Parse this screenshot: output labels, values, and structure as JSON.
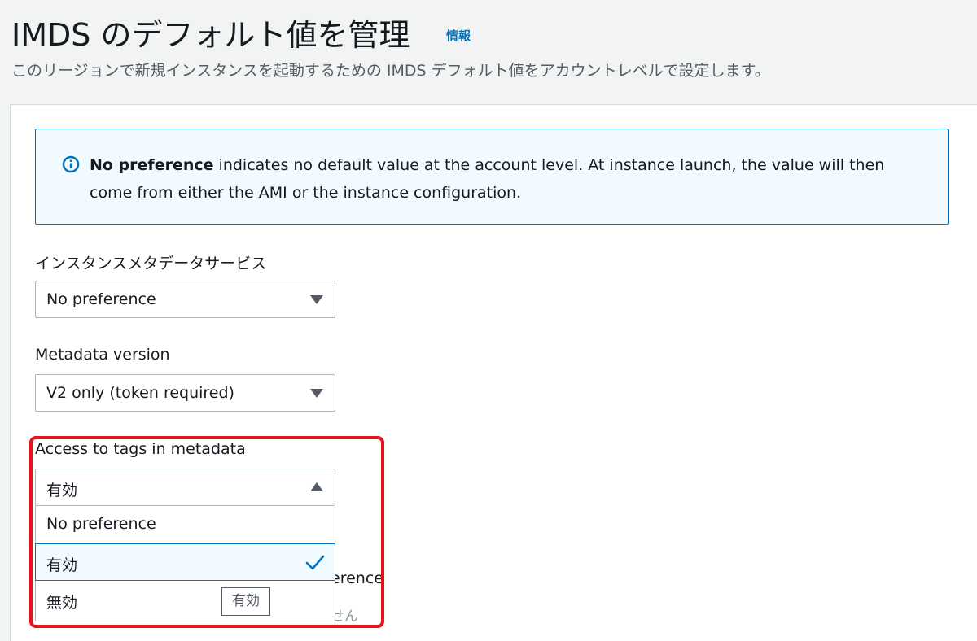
{
  "header": {
    "title": "IMDS のデフォルト値を管理",
    "info_link": "情報",
    "subtitle": "このリージョンで新規インスタンスを起動するための IMDS デフォルト値をアカウントレベルで設定します。"
  },
  "alert": {
    "icon": "info-icon",
    "bold_text": "No preference",
    "text": " indicates no default value at the account level. At instance launch, the value will then come from either the AMI or the instance configuration."
  },
  "fields": {
    "metadata_service": {
      "label": "インスタンスメタデータサービス",
      "value": "No preference"
    },
    "metadata_version": {
      "label": "Metadata version",
      "value": "V2 only (token required)"
    },
    "tags_access": {
      "label": "Access to tags in metadata",
      "value": "有効",
      "options": [
        "No preference",
        "有効",
        "無効"
      ],
      "selected_index": 1
    }
  },
  "behind": {
    "partial_label": "erence",
    "partial_muted": "せん"
  },
  "tooltip": "有効",
  "colors": {
    "accent": "#0073bb",
    "highlight": "#e8131a",
    "alert_bg": "#f1faff"
  }
}
